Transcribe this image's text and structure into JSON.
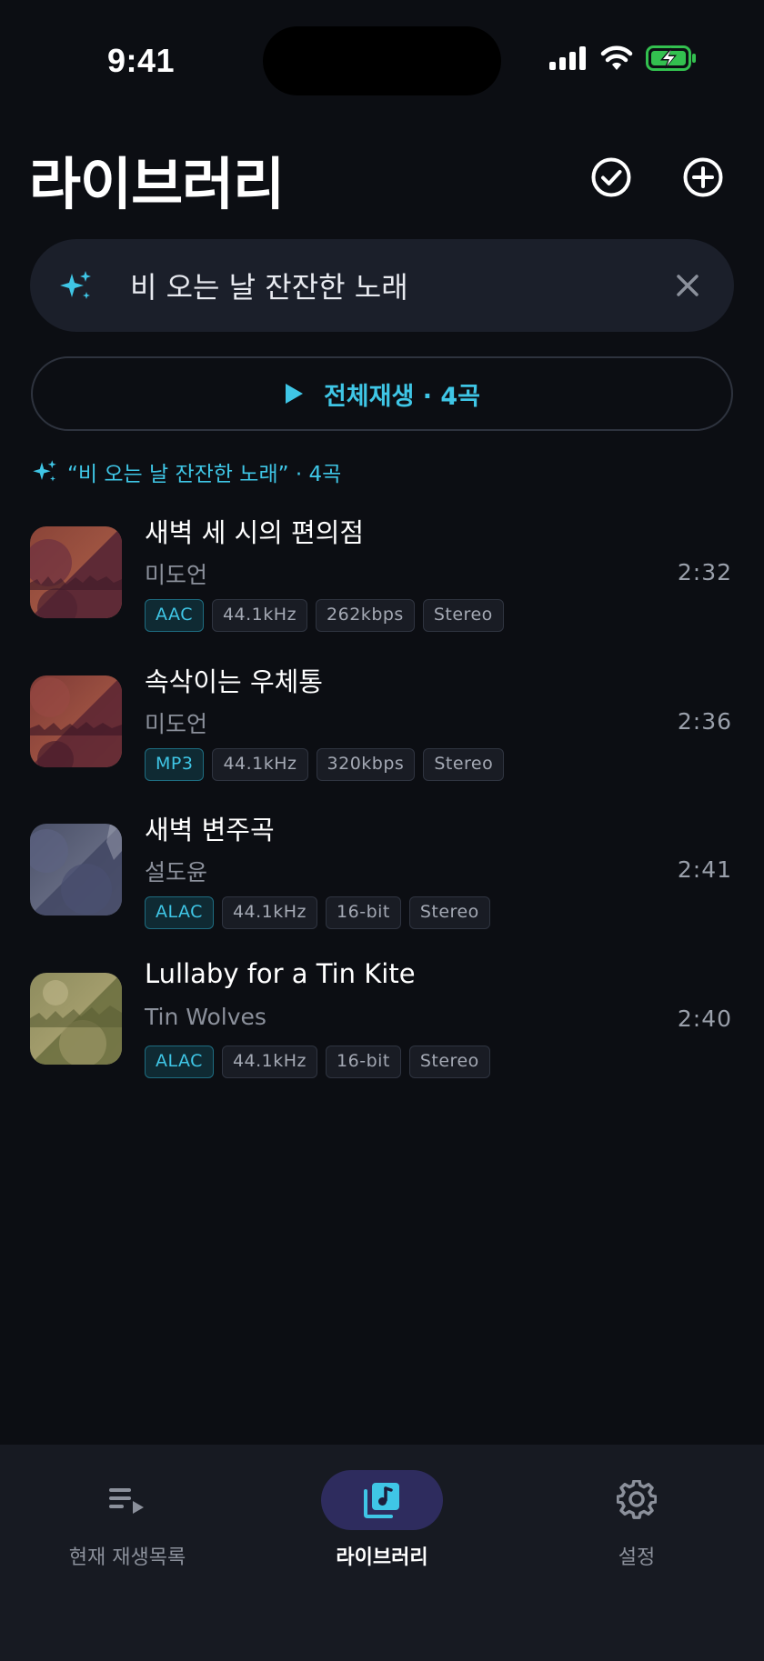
{
  "status_bar": {
    "time": "9:41",
    "icons": [
      "cellular-signal-icon",
      "wifi-icon",
      "battery-charging-icon"
    ],
    "battery_color": "#33c04f"
  },
  "header": {
    "title": "라이브러리",
    "select_icon": "check-circle-icon",
    "add_icon": "plus-circle-icon"
  },
  "search": {
    "value": "비 오는 날 잔잔한 노래",
    "icon": "sparkle-icon",
    "clear_icon": "close-icon"
  },
  "play_all": {
    "label": "전체재생 · 4곡",
    "icon": "play-icon"
  },
  "result_caption": {
    "text": "“비 오는 날 잔잔한 노래” · 4곡",
    "icon": "sparkle-icon"
  },
  "tracks": [
    {
      "title": "새벽 세 시의 편의점",
      "artist": "미도언",
      "duration": "2:32",
      "badges": [
        "AAC",
        "44.1kHz",
        "262kbps",
        "Stereo"
      ]
    },
    {
      "title": "속삭이는 우체통",
      "artist": "미도언",
      "duration": "2:36",
      "badges": [
        "MP3",
        "44.1kHz",
        "320kbps",
        "Stereo"
      ]
    },
    {
      "title": "새벽 변주곡",
      "artist": "설도윤",
      "duration": "2:41",
      "badges": [
        "ALAC",
        "44.1kHz",
        "16-bit",
        "Stereo"
      ]
    },
    {
      "title": "Lullaby for a Tin Kite",
      "artist": "Tin Wolves",
      "duration": "2:40",
      "badges": [
        "ALAC",
        "44.1kHz",
        "16-bit",
        "Stereo"
      ]
    }
  ],
  "tab_bar": {
    "tabs": [
      {
        "label": "현재 재생목록",
        "icon": "queue-music-icon",
        "active": false
      },
      {
        "label": "라이브러리",
        "icon": "library-music-icon",
        "active": true
      },
      {
        "label": "설정",
        "icon": "gear-icon",
        "active": false
      }
    ]
  },
  "colors": {
    "background": "#0c0e13",
    "accent": "#3fc6e6",
    "active_tab_pill": "#2e2c5e"
  }
}
